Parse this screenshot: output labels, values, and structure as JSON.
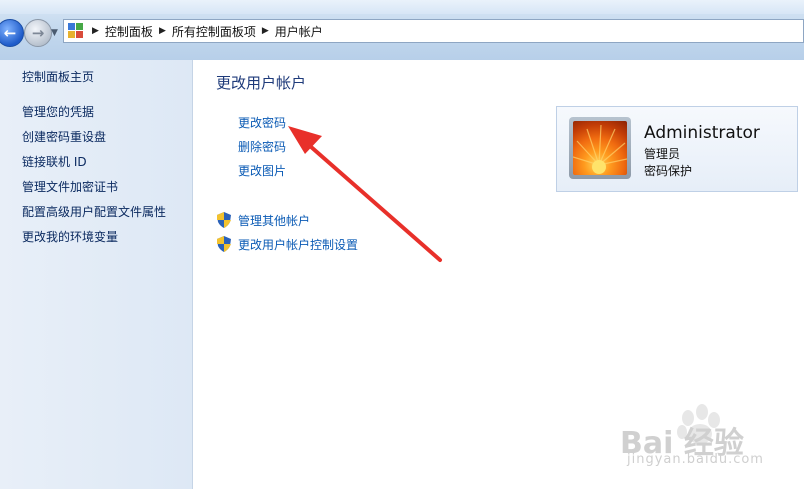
{
  "address_bar": {
    "breadcrumbs": [
      "控制面板",
      "所有控制面板项",
      "用户帐户"
    ]
  },
  "left_pane": {
    "home_link": "控制面板主页",
    "links": [
      "管理您的凭据",
      "创建密码重设盘",
      "链接联机 ID",
      "管理文件加密证书",
      "配置高级用户配置文件属性",
      "更改我的环境变量"
    ]
  },
  "main": {
    "title": "更改用户帐户",
    "tasks": [
      "更改密码",
      "删除密码",
      "更改图片"
    ],
    "admin_tasks": [
      "管理其他帐户",
      "更改用户帐户控制设置"
    ]
  },
  "account": {
    "name": "Administrator",
    "role": "管理员",
    "status": "密码保护"
  },
  "annotation": {
    "arrow_color": "#e8302a"
  },
  "watermark": {
    "brand": "Bai 经验",
    "url": "jingyan.baidu.com"
  },
  "colors": {
    "link": "#0b5bb5",
    "heading": "#1e3a7a",
    "left_pane_bg": "#e3ecf7"
  }
}
